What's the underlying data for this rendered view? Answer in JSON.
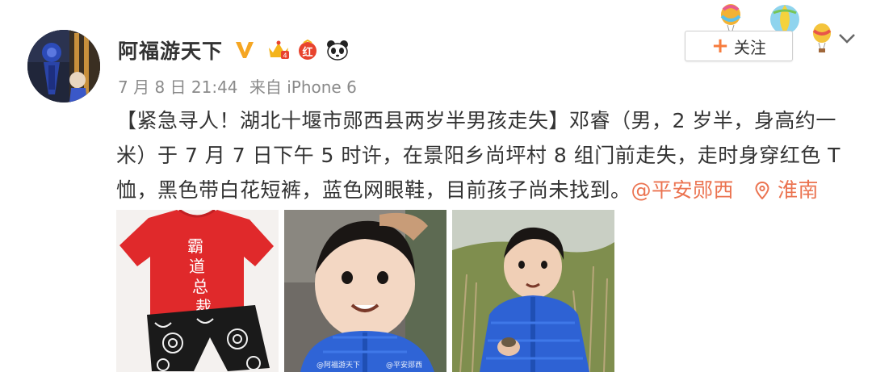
{
  "user": {
    "name": "阿福游天下",
    "badges": [
      "verified-v-icon",
      "crown-level-icon",
      "red-badge-icon",
      "panda-icon"
    ],
    "red_badge_label": "红"
  },
  "meta": {
    "date": "7 月 8 日 21:44",
    "source": "来自 iPhone 6"
  },
  "post": {
    "text": "【紧急寻人！湖北十堰市郧西县两岁半男孩走失】邓睿（男，2 岁半，身高约一米）于 7 月 7 日下午 5 时许，在景阳乡尚坪村 8 组门前走失，走时身穿红色 T 恤，黑色带白花短裤，蓝色网眼鞋，目前孩子尚未找到。",
    "mention": "@平安郧西",
    "location": "淮南"
  },
  "actions": {
    "follow_plus": "+",
    "follow_label": "关注"
  },
  "photos": [
    {
      "name": "photo-outfit",
      "shirt_text": [
        "霸",
        "道",
        "总",
        "裁"
      ]
    },
    {
      "name": "photo-child-portrait",
      "watermarks": [
        "@阿福游天下",
        "@平安郧西"
      ]
    },
    {
      "name": "photo-child-outdoors"
    }
  ],
  "colors": {
    "link": "#eb7350",
    "verified": "#f5a623",
    "red_badge": "#e8442e"
  }
}
